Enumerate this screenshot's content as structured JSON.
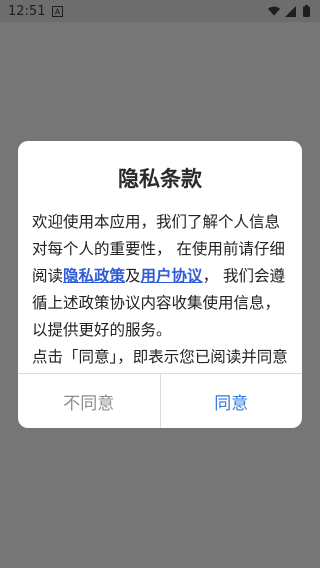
{
  "status_bar": {
    "time": "12:51",
    "notification_icon": "a-square-icon",
    "wifi_icon": "wifi-icon",
    "signal_icon": "signal-icon",
    "battery_icon": "battery-icon"
  },
  "dialog": {
    "title": "隐私条款",
    "body": {
      "intro": "欢迎使用本应用，我们了解个人信息对每个人的重要性， 在使用前请仔细阅读",
      "privacy_link": "隐私政策",
      "and": "及",
      "user_link": "用户协议",
      "rest": "， 我们会遵循上述政策协议内容收集使用信息，以提供更好的服务。",
      "partial": "点击「同意」，即表示您已阅读并同意"
    },
    "disagree_label": "不同意",
    "agree_label": "同意"
  },
  "colors": {
    "link": "#2f5bd6",
    "agree": "#2f7ae6",
    "disagree": "#8c8c8c",
    "overlay": "#767676"
  }
}
